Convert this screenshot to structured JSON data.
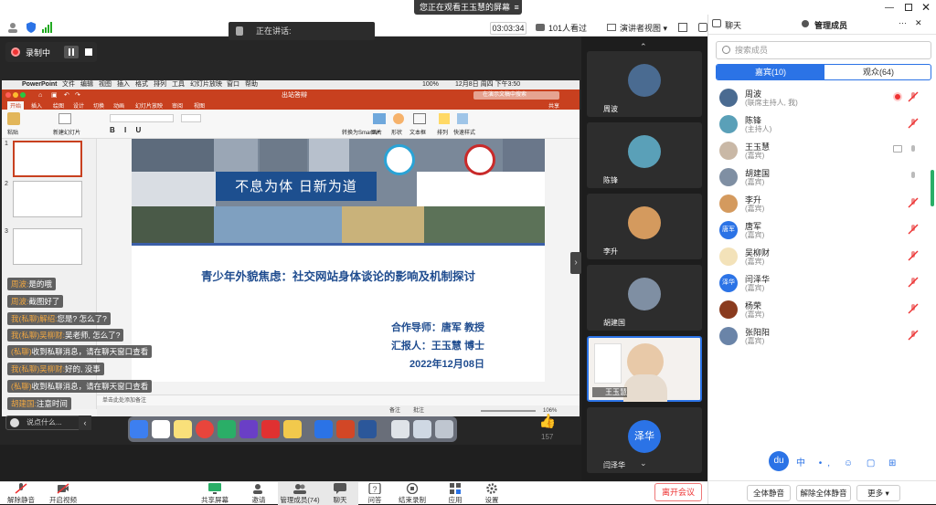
{
  "topbar": {
    "sharing_banner": "您正在观看王玉慧的屏幕",
    "timer": "03:03:34",
    "viewers": "101人看过",
    "view_mode": "演讲者视图",
    "window_controls": [
      "minimize-icon",
      "restore-icon",
      "close-icon"
    ]
  },
  "share": {
    "talking_label": "正在讲话:",
    "recording_label": "录制中"
  },
  "ppt": {
    "menubar": [
      "PowerPoint",
      "文件",
      "编辑",
      "视图",
      "插入",
      "格式",
      "排列",
      "工具",
      "幻灯片放映",
      "窗口",
      "帮助"
    ],
    "clock": "12月8日 周四 下午3:50",
    "battery": "100%",
    "doc_title": "出站答辩",
    "search_placeholder": "在演示文稿中搜索",
    "share_label": "共享",
    "tabs": [
      "开始",
      "插入",
      "绘图",
      "设计",
      "切换",
      "动画",
      "幻灯片放映",
      "审阅",
      "视图"
    ],
    "ribbon_groups": [
      "粘贴",
      "新建幻灯片",
      "图片",
      "形状",
      "文本框",
      "排列",
      "快速样式",
      "转换为SmartArt"
    ],
    "thumb_numbers": [
      "1",
      "2",
      "3"
    ],
    "slide": {
      "calligraphy": "不息为体 日新为道",
      "title": "青少年外貌焦虑：社交网站身体谈论的影响及机制探讨",
      "advisor": "合作导师：唐军 教授",
      "reporter": "汇报人：王玉慧 博士",
      "date": "2022年12月08日"
    },
    "notes_placeholder": "单击此处添加备注",
    "status": {
      "notes": "备注",
      "comments": "批注",
      "zoom": "106%"
    }
  },
  "chat": {
    "messages": [
      {
        "who": "周波:",
        "text": "是的哦"
      },
      {
        "who": "周波:",
        "text": "截图好了"
      },
      {
        "who": "我(私聊)解绍:",
        "text": "您是? 怎么了?"
      },
      {
        "who": "我(私聊)吴柳财:",
        "text": "吴老师, 怎么了?"
      },
      {
        "who": "(私聊)",
        "text": "收到私聊消息，请在聊天窗口查看"
      },
      {
        "who": "我(私聊)吴柳财:",
        "text": "好的, 没事"
      },
      {
        "who": "(私聊)",
        "text": "收到私聊消息，请在聊天窗口查看"
      },
      {
        "who": "胡建国:",
        "text": "注意时间"
      }
    ],
    "input_placeholder": "说点什么..."
  },
  "dock": {
    "badge": "157"
  },
  "gallery": {
    "tiles": [
      {
        "name": "周波"
      },
      {
        "name": "陈锋"
      },
      {
        "name": "李升"
      },
      {
        "name": "胡建国"
      },
      {
        "name": "王玉慧"
      },
      {
        "name": "闫泽华",
        "avatar_text": "泽华"
      }
    ]
  },
  "panel": {
    "tab_chat": "聊天",
    "tab_members": "管理成员",
    "search_placeholder": "搜索成员",
    "seg_guests": "嘉宾(10)",
    "seg_audience": "观众(64)",
    "participants": [
      {
        "name": "周波",
        "role": "(联席主持人, 我)"
      },
      {
        "name": "陈锋",
        "role": "(主持人)"
      },
      {
        "name": "王玉慧",
        "role": "(嘉宾)"
      },
      {
        "name": "胡建国",
        "role": "(嘉宾)"
      },
      {
        "name": "李升",
        "role": "(嘉宾)"
      },
      {
        "name": "唐军",
        "role": "(嘉宾)",
        "avatar_text": "唐军"
      },
      {
        "name": "吴柳财",
        "role": "(嘉宾)"
      },
      {
        "name": "闫泽华",
        "role": "(嘉宾)",
        "avatar_text": "泽华"
      },
      {
        "name": "杨荣",
        "role": "(嘉宾)"
      },
      {
        "name": "张阳阳",
        "role": "(嘉宾)"
      }
    ],
    "mute_all": "全体静音",
    "unmute_all": "解除全体静音",
    "more": "更多"
  },
  "toolbar": {
    "items": [
      "解除静音",
      "开启视频",
      "共享屏幕",
      "邀请",
      "管理成员(74)",
      "聊天",
      "问答",
      "结束录制",
      "应用",
      "设置"
    ],
    "leave": "离开会议"
  },
  "colors": {
    "accent": "#2b73e6",
    "ppt_red": "#c8401f",
    "slide_blue": "#1f4c8f",
    "danger": "#e33333"
  }
}
